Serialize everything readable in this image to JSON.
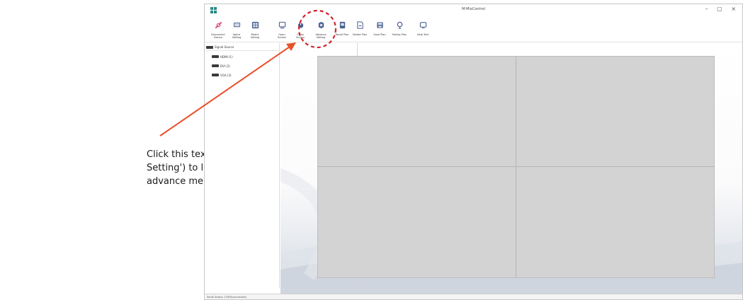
{
  "annotation": {
    "callout_text": "Click this text ('Advance Setting') to launch the advance menu",
    "arrow_color": "#e8502a",
    "circle_color": "#d2232a"
  },
  "window": {
    "title": "M-MixControl",
    "controls": "– ▢ ×"
  },
  "toolbar": {
    "items": [
      {
        "label": "Disconnect Device",
        "icon": "disconnect-icon",
        "color": "#d94a7a"
      },
      {
        "label": "Splice Setting",
        "icon": "monitor-icon",
        "color": "#3c5a99"
      },
      {
        "label": "Matrix Setting",
        "icon": "matrix-icon",
        "color": "#3c5a99"
      },
      {
        "label": "Open Screen",
        "icon": "screen-icon",
        "color": "#3c5a99"
      },
      {
        "label": "Close Screen",
        "icon": "power-icon",
        "color": "#3c5a99"
      },
      {
        "label": "Advance Setting",
        "icon": "advance-setting-icon",
        "color": "#3c5a99"
      },
      {
        "label": "Recall Plan",
        "icon": "recall-icon",
        "color": "#3c5a99"
      },
      {
        "label": "Delete Plan",
        "icon": "delete-plan-icon",
        "color": "#3c5a99"
      },
      {
        "label": "Save Plan",
        "icon": "save-icon",
        "color": "#3c5a99"
      },
      {
        "label": "Polling Plan",
        "icon": "polling-icon",
        "color": "#3c5a99"
      },
      {
        "label": "Help Text",
        "icon": "help-icon",
        "color": "#3c5a99"
      }
    ]
  },
  "sidebar": {
    "header": "Signal Source",
    "items": [
      {
        "label": "HDMI (1)"
      },
      {
        "label": "DVI (2)"
      },
      {
        "label": "VGA (3)"
      }
    ]
  },
  "status": {
    "text": "Serial Status: COM3(connected)"
  }
}
